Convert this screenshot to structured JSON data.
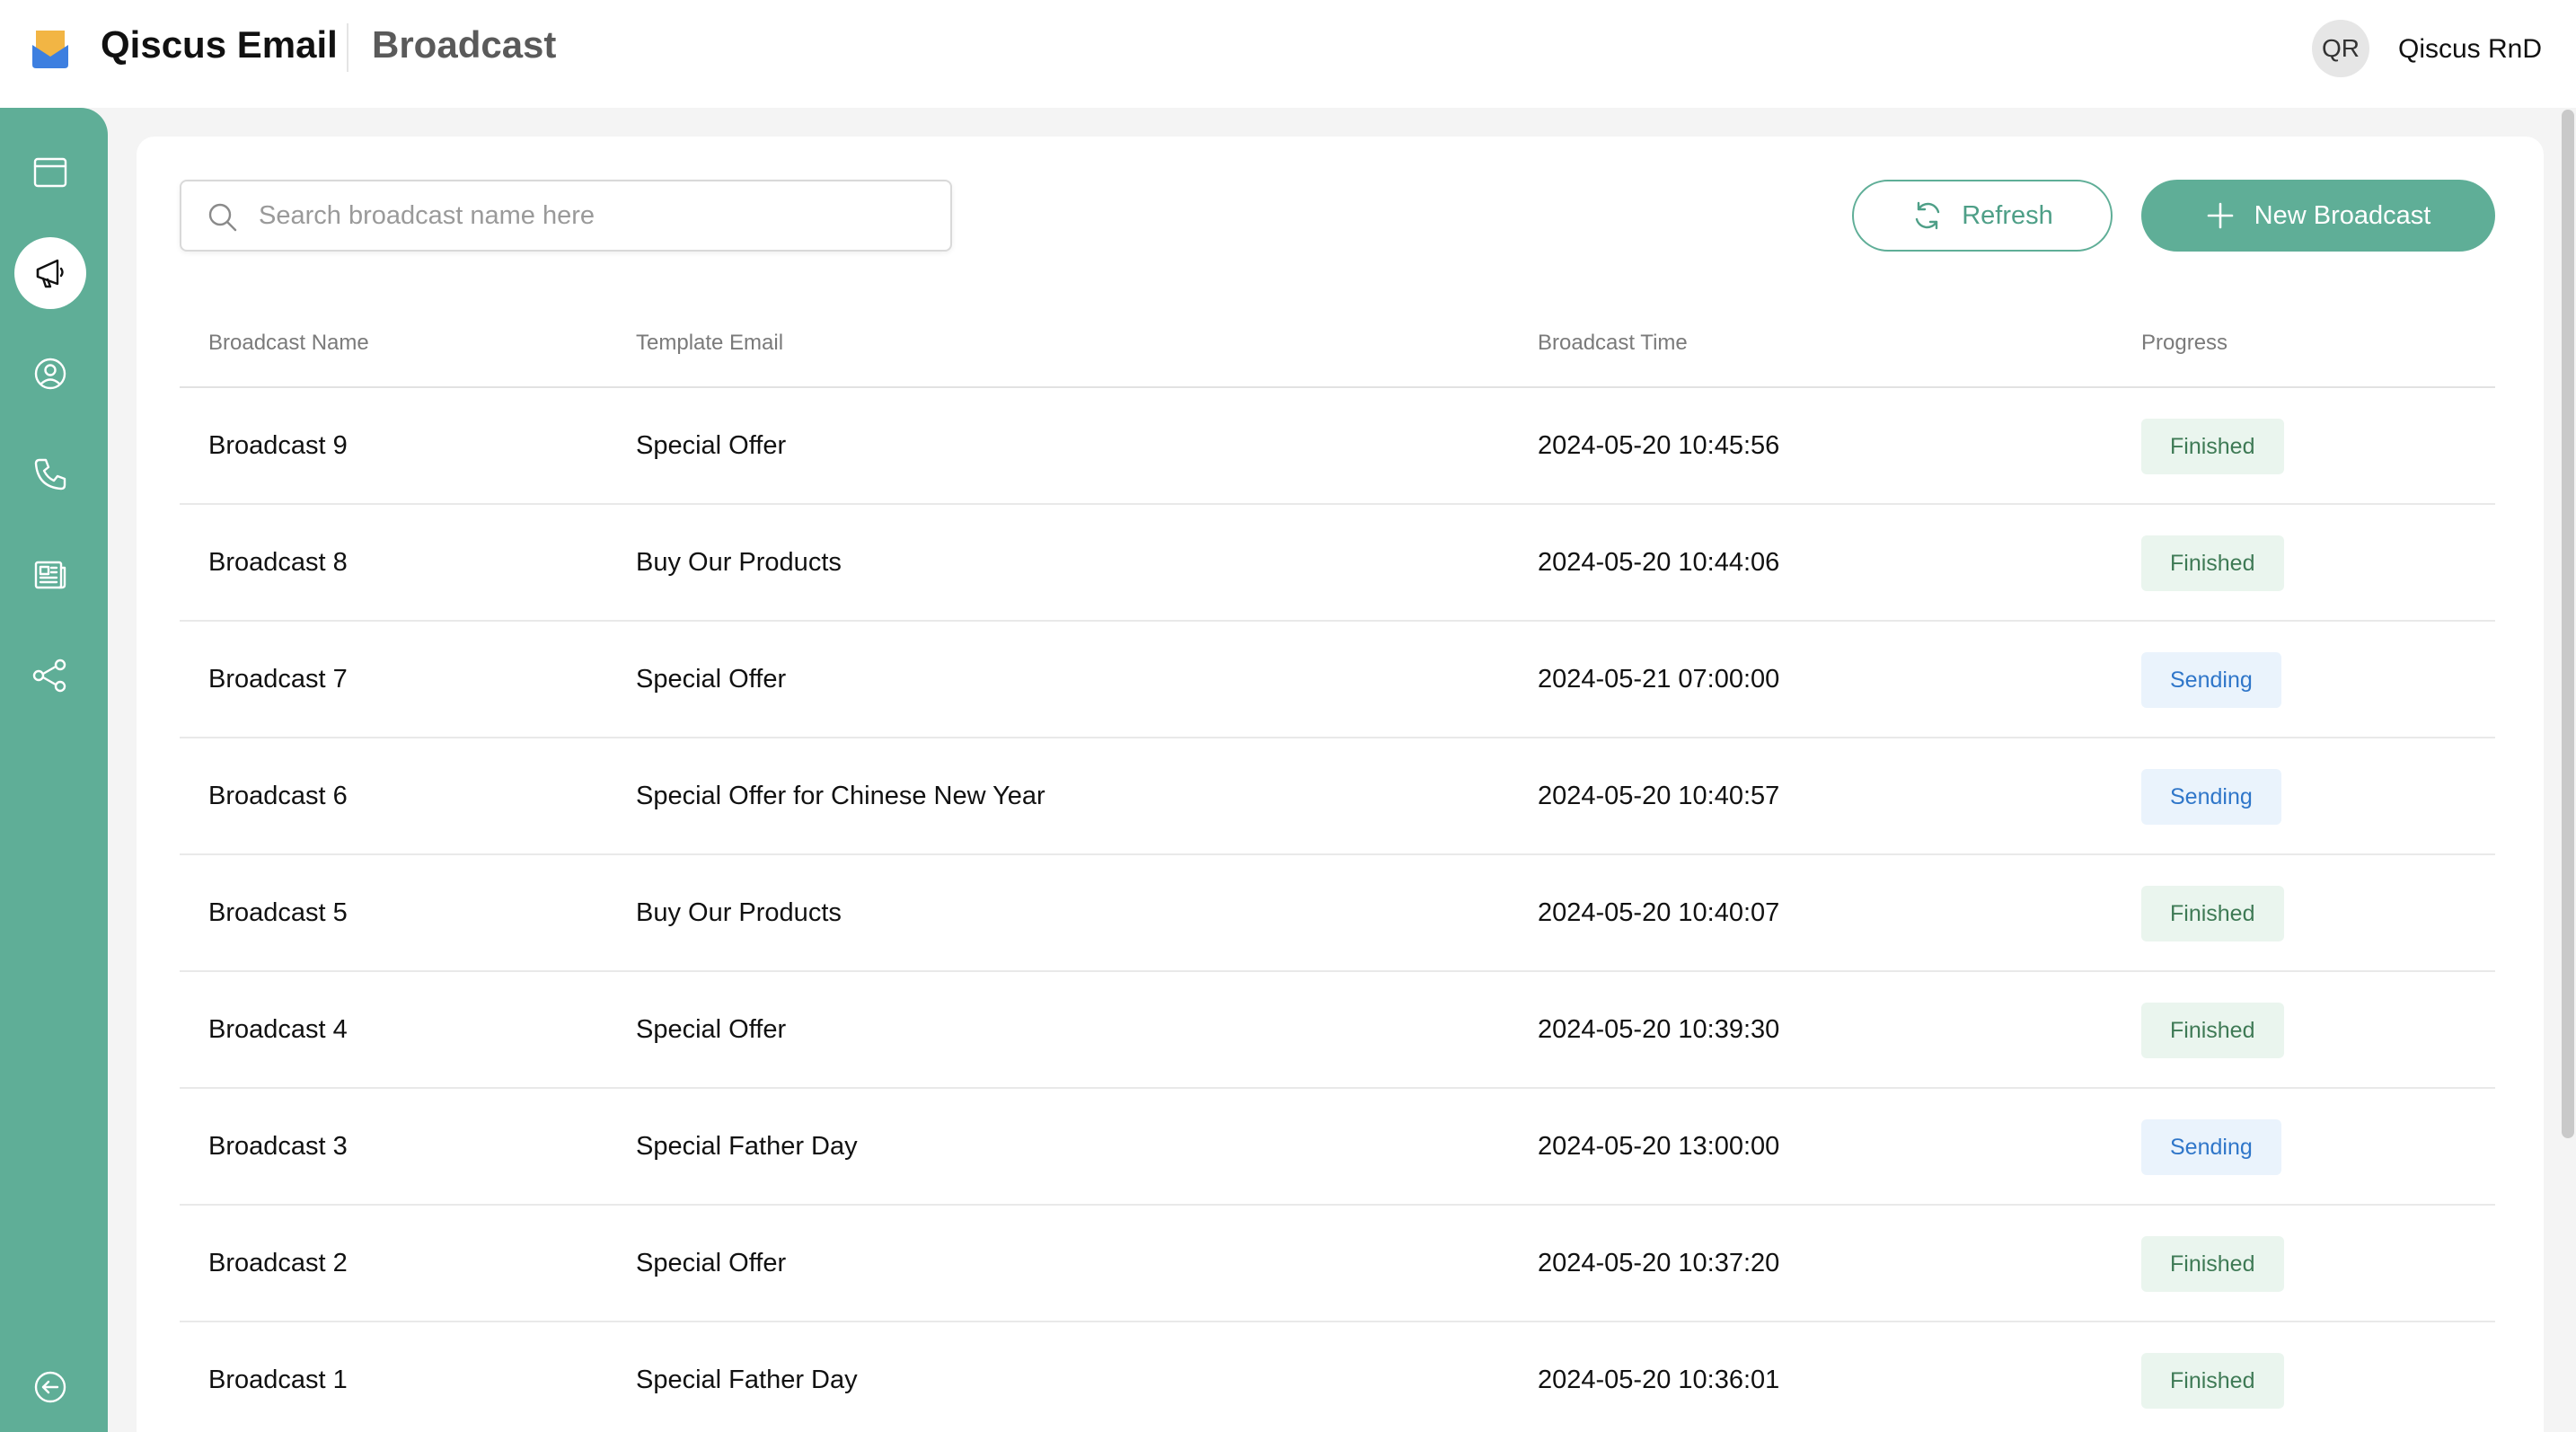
{
  "header": {
    "app_name": "Qiscus Email",
    "page_title": "Broadcast",
    "user_initials": "QR",
    "user_name": "Qiscus RnD"
  },
  "colors": {
    "accent": "#5fae97",
    "finished_bg": "#eaf5ee",
    "finished_text": "#3e7a55",
    "sending_bg": "#eaf3fc",
    "sending_text": "#2f76c9"
  },
  "sidebar": {
    "items": [
      {
        "icon": "browser-window-icon"
      },
      {
        "icon": "megaphone-icon",
        "active": true
      },
      {
        "icon": "user-circle-icon"
      },
      {
        "icon": "phone-icon"
      },
      {
        "icon": "newspaper-icon"
      },
      {
        "icon": "share-nodes-icon"
      }
    ],
    "collapse_icon": "arrow-left-circle-icon"
  },
  "toolbar": {
    "search_placeholder": "Search broadcast name here",
    "refresh_label": "Refresh",
    "new_label": "New Broadcast"
  },
  "table": {
    "columns": [
      "Broadcast Name",
      "Template Email",
      "Broadcast Time",
      "Progress"
    ],
    "rows": [
      {
        "name": "Broadcast 9",
        "template": "Special Offer",
        "time": "2024-05-20 10:45:56",
        "progress": "Finished"
      },
      {
        "name": "Broadcast 8",
        "template": "Buy Our Products",
        "time": "2024-05-20 10:44:06",
        "progress": "Finished"
      },
      {
        "name": "Broadcast 7",
        "template": "Special Offer",
        "time": "2024-05-21 07:00:00",
        "progress": "Sending"
      },
      {
        "name": "Broadcast 6",
        "template": "Special Offer for Chinese New Year",
        "time": "2024-05-20 10:40:57",
        "progress": "Sending"
      },
      {
        "name": "Broadcast 5",
        "template": "Buy Our Products",
        "time": "2024-05-20 10:40:07",
        "progress": "Finished"
      },
      {
        "name": "Broadcast 4",
        "template": "Special Offer",
        "time": "2024-05-20 10:39:30",
        "progress": "Finished"
      },
      {
        "name": "Broadcast 3",
        "template": "Special Father Day",
        "time": "2024-05-20 13:00:00",
        "progress": "Sending"
      },
      {
        "name": "Broadcast 2",
        "template": "Special Offer",
        "time": "2024-05-20 10:37:20",
        "progress": "Finished"
      },
      {
        "name": "Broadcast 1",
        "template": "Special Father Day",
        "time": "2024-05-20 10:36:01",
        "progress": "Finished"
      }
    ]
  }
}
